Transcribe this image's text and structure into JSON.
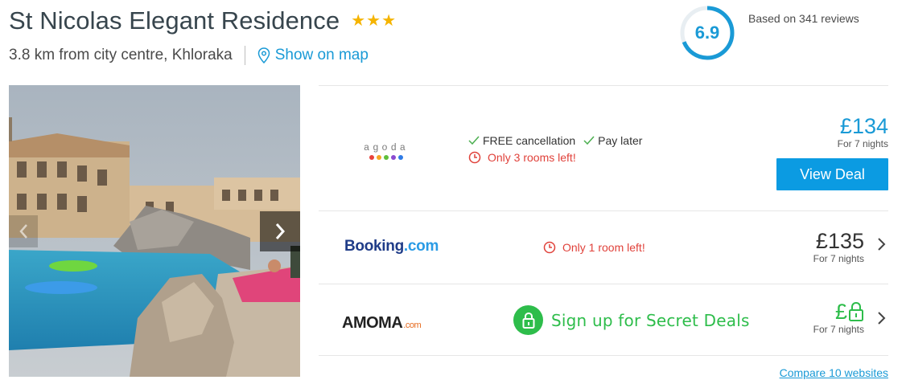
{
  "hotel": {
    "name": "St Nicolas Elegant Residence",
    "stars": 3,
    "location": "3.8 km from city centre, Khloraka",
    "map_link": "Show on map"
  },
  "rating": {
    "score": "6.9",
    "reviews": "Based on 341 reviews",
    "fill_fraction": 0.69
  },
  "deals": [
    {
      "provider": "agoda",
      "features": [
        "FREE cancellation",
        "Pay later"
      ],
      "alert": "Only 3 rooms left!",
      "price": "£134",
      "nights": "For 7 nights",
      "button": "View Deal"
    },
    {
      "provider": "Booking.com",
      "provider_main": "Booking",
      "provider_suffix": ".com",
      "alert": "Only 1 room left!",
      "price": "£135",
      "nights": "For 7 nights"
    },
    {
      "provider": "AMOMA.com",
      "provider_main": "AMOMA",
      "provider_suffix": ".com",
      "secret": "Sign up for Secret Deals",
      "price": "£",
      "nights": "For 7 nights"
    }
  ],
  "compare": "Compare 10 websites",
  "colors": {
    "accent": "#1a9ad6",
    "button": "#0b9be2",
    "alert": "#e0413a",
    "success": "#2ebd4b",
    "star": "#f5b400"
  }
}
